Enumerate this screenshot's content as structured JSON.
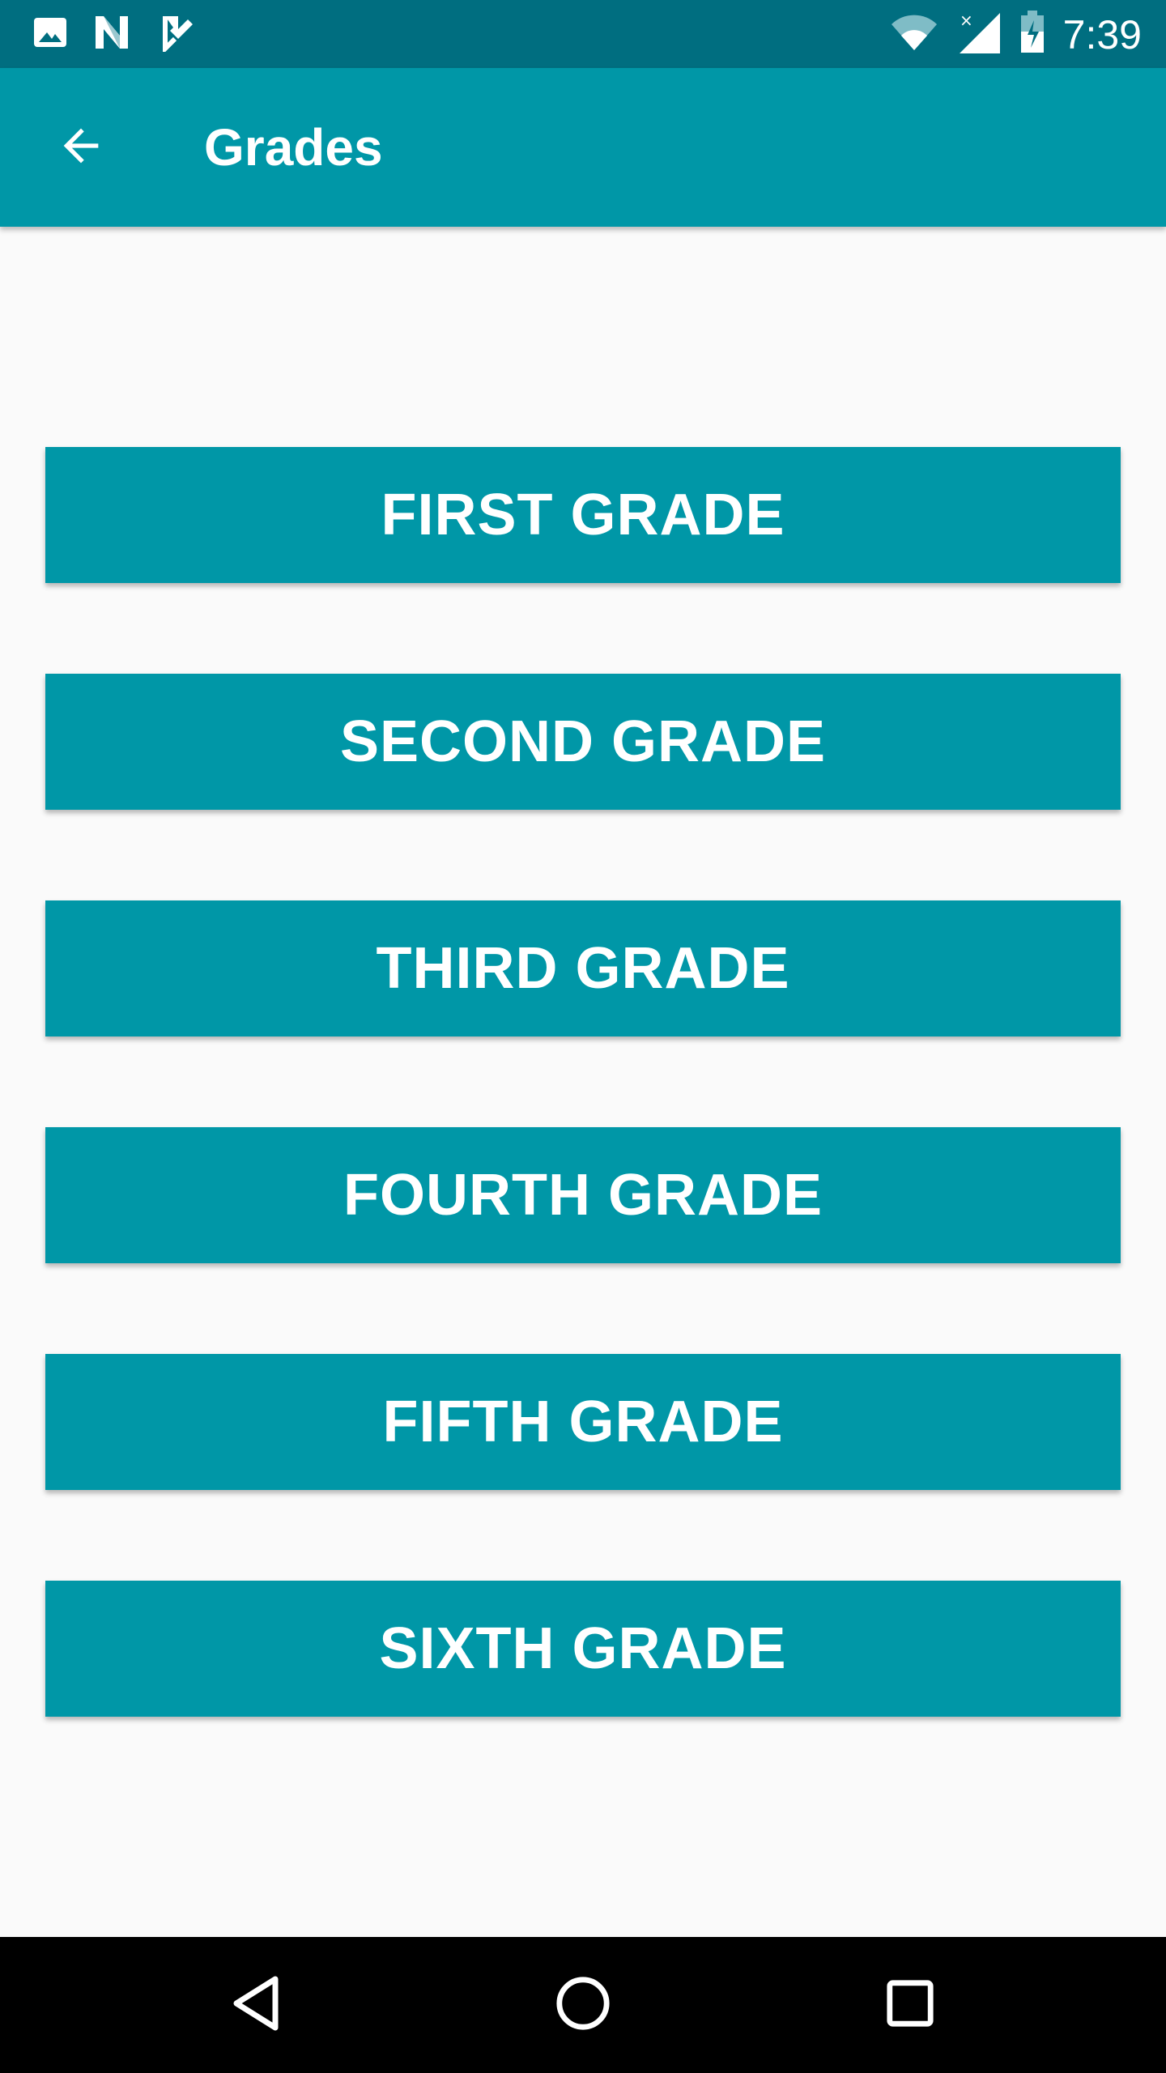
{
  "status_bar": {
    "time": "7:39",
    "left_icons": [
      "image-icon",
      "n-logo-icon",
      "task-check-icon"
    ],
    "right_icons": [
      "wifi-icon",
      "cell-signal-icon",
      "battery-charging-icon"
    ]
  },
  "app_bar": {
    "title": "Grades",
    "back_icon": "arrow-back-icon"
  },
  "grades": [
    {
      "label": "FIRST GRADE"
    },
    {
      "label": "SECOND GRADE"
    },
    {
      "label": "THIRD GRADE"
    },
    {
      "label": "FOURTH GRADE"
    },
    {
      "label": "FIFTH GRADE"
    },
    {
      "label": "SIXTH GRADE"
    }
  ],
  "nav_bar": {
    "icons": [
      "back-triangle-icon",
      "home-circle-icon",
      "recents-square-icon"
    ]
  },
  "colors": {
    "status_bar": "#006e80",
    "app_bar": "#0097a7",
    "button": "#0097a7",
    "background": "#fafafa"
  }
}
